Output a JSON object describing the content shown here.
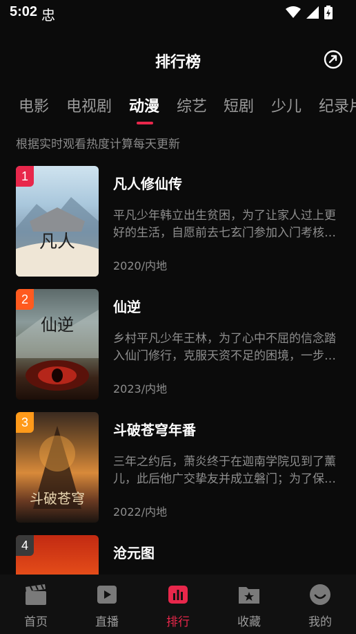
{
  "status_bar": {
    "time": "5:02",
    "app_glyph": "忠"
  },
  "header": {
    "title": "排行榜",
    "share_icon": "share-icon"
  },
  "tabs": [
    {
      "label": "电影"
    },
    {
      "label": "电视剧"
    },
    {
      "label": "动漫",
      "active": true
    },
    {
      "label": "综艺"
    },
    {
      "label": "短剧"
    },
    {
      "label": "少儿"
    },
    {
      "label": "纪录片"
    }
  ],
  "subtitle": "根据实时观看热度计算每天更新",
  "ranking": [
    {
      "rank": "1",
      "title": "凡人修仙传",
      "desc": "平凡少年韩立出生贫困，为了让家人过上更好的生活，自愿前去七玄门参加入门考核，最终被墨大夫收为弟子。",
      "meta": "2020/内地",
      "rank_color": "#e8274b"
    },
    {
      "rank": "2",
      "title": "仙逆",
      "desc": "乡村平凡少年王林，为了心中不屈的信念踏入仙门修行，克服天资不足的困境，一步步踏上逆天之路。",
      "meta": "2023/内地",
      "rank_color": "#ff5a1f"
    },
    {
      "rank": "3",
      "title": "斗破苍穹年番",
      "desc": "三年之约后，萧炎终于在迦南学院见到了薰儿，此后他广交挚友并成立磐门；为了保护身边之人不断变强。",
      "meta": "2022/内地",
      "rank_color": "#ff9a1a"
    },
    {
      "rank": "4",
      "title": "沧元图",
      "desc": "",
      "meta": "",
      "rank_color": "#3a3a3a"
    }
  ],
  "bottom_nav": [
    {
      "label": "首页",
      "icon": "clapperboard-icon"
    },
    {
      "label": "直播",
      "icon": "play-icon"
    },
    {
      "label": "排行",
      "icon": "chart-icon",
      "active": true
    },
    {
      "label": "收藏",
      "icon": "folder-star-icon"
    },
    {
      "label": "我的",
      "icon": "smile-icon"
    }
  ],
  "colors": {
    "accent": "#e8274b",
    "background": "#0b0b0b",
    "muted": "#8e8e8e"
  }
}
